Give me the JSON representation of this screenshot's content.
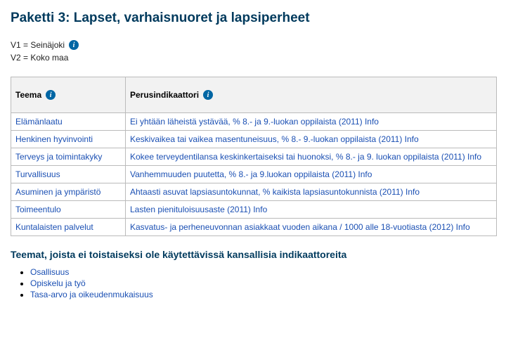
{
  "title": "Paketti 3: Lapset, varhaisnuoret ja lapsiperheet",
  "legend": {
    "v1": "V1 = Seinäjoki",
    "v2": "V2 = Koko maa"
  },
  "table": {
    "headers": {
      "teema": "Teema",
      "perusindikaattori": "Perusindikaattori"
    },
    "rows": [
      {
        "teema": "Elämänlaatu",
        "indikaattori": "Ei yhtään läheistä ystävää, % 8.- ja 9.-luokan oppilaista (2011) Info"
      },
      {
        "teema": "Henkinen hyvinvointi",
        "indikaattori": "Keskivaikea tai vaikea masentuneisuus, % 8.- 9.-luokan oppilaista (2011) Info"
      },
      {
        "teema": "Terveys ja toimintakyky",
        "indikaattori": "Kokee terveydentilansa keskinkertaiseksi tai huonoksi, % 8.- ja 9. luokan oppilaista (2011) Info"
      },
      {
        "teema": "Turvallisuus",
        "indikaattori": "Vanhemmuuden puutetta, % 8.- ja 9.luokan oppilaista (2011) Info"
      },
      {
        "teema": "Asuminen ja ympäristö",
        "indikaattori": "Ahtaasti asuvat lapsiasuntokunnat, % kaikista lapsiasuntokunnista (2011) Info"
      },
      {
        "teema": "Toimeentulo",
        "indikaattori": "Lasten pienituloisuusaste (2011) Info"
      },
      {
        "teema": "Kuntalaisten palvelut",
        "indikaattori": "Kasvatus- ja perheneuvonnan asiakkaat vuoden aikana / 1000 alle 18-vuotiasta (2012) Info"
      }
    ]
  },
  "missing": {
    "heading": "Teemat, joista ei toistaiseksi ole käytettävissä kansallisia indikaattoreita",
    "items": [
      "Osallisuus",
      "Opiskelu ja työ",
      "Tasa-arvo ja oikeudenmukaisuus"
    ]
  },
  "icons": {
    "info_glyph": "i"
  }
}
